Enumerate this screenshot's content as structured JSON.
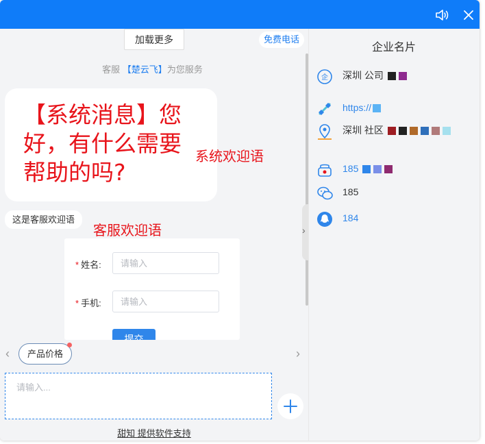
{
  "header": {
    "sound_icon": "speaker-icon",
    "close_icon": "close-icon"
  },
  "chat": {
    "load_more": "加载更多",
    "free_call": "免费电话",
    "agent_prefix": "客服",
    "agent_name": "【楚云飞】",
    "agent_suffix": "为您服务",
    "system_message": "【系统消息】您好，有什么需要帮助的吗?",
    "system_annotation": "系统欢迎语",
    "agent_message": "这是客服欢迎语",
    "agent_annotation": "客服欢迎语",
    "form": {
      "name_label": "姓名:",
      "name_placeholder": "请输入",
      "phone_label": "手机:",
      "phone_placeholder": "请输入",
      "submit_label": "提交"
    },
    "quick_reply": "产品价格",
    "input_placeholder": "请输入...",
    "footer": "甜知 提供软件支持"
  },
  "business_card": {
    "title": "企业名片",
    "company": "深圳 公司",
    "website": "https://",
    "address": "深圳 社区",
    "phone": "185",
    "wechat": "185",
    "qq": "184"
  },
  "colors": {
    "accent": "#0f7cf9",
    "annotation_red": "#e8141b",
    "link_blue": "#2f86ea"
  }
}
